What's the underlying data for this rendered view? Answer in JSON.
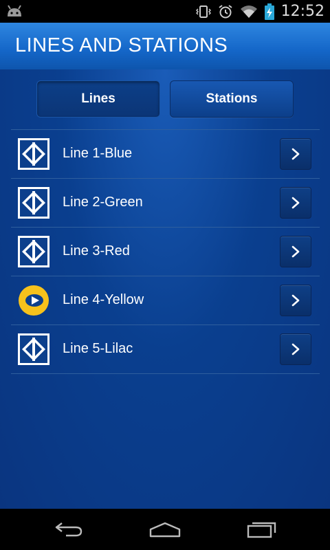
{
  "status_bar": {
    "time": "12:52",
    "icons": [
      "android-icon",
      "vibrate-icon",
      "alarm-icon",
      "wifi-icon",
      "battery-charging-icon"
    ]
  },
  "header": {
    "title": "LINES AND STATIONS"
  },
  "tabs": [
    {
      "label": "Lines",
      "selected": true
    },
    {
      "label": "Stations",
      "selected": false
    }
  ],
  "lines": [
    {
      "label": "Line 1-Blue",
      "icon": "metro-logo-icon"
    },
    {
      "label": "Line 2-Green",
      "icon": "metro-logo-icon"
    },
    {
      "label": "Line 3-Red",
      "icon": "metro-logo-icon"
    },
    {
      "label": "Line 4-Yellow",
      "icon": "viaquatro-logo-icon"
    },
    {
      "label": "Line 5-Lilac",
      "icon": "metro-logo-icon"
    }
  ],
  "nav_bar": {
    "icons": [
      "back-icon",
      "home-icon",
      "recent-apps-icon"
    ]
  },
  "colors": {
    "app_background": "#0a3f8f",
    "title_bar": "#1466c8",
    "yellow_logo": "#f7c21c",
    "text": "#ffffff"
  }
}
